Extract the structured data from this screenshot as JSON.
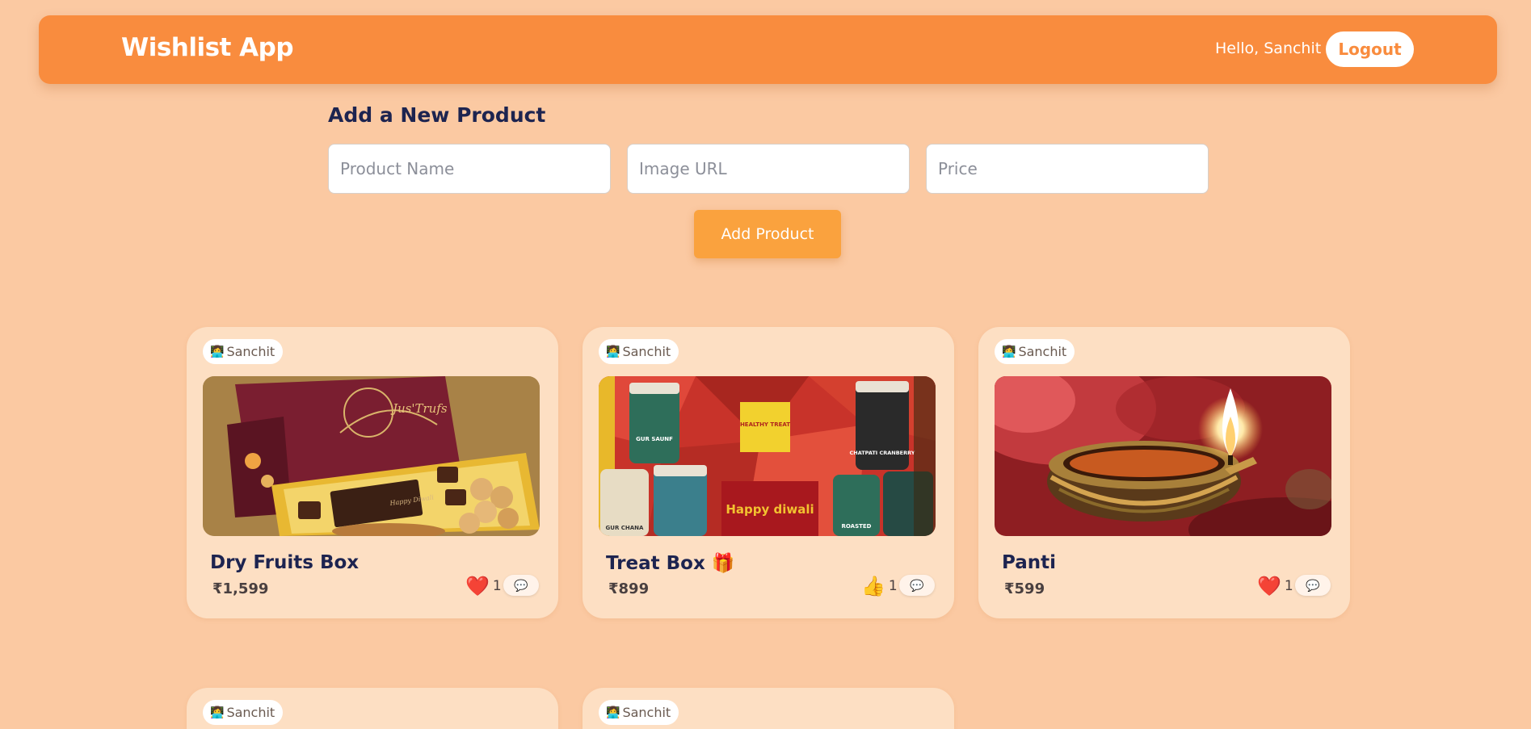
{
  "header": {
    "brand": "Wishlist App",
    "greeting": "Hello, Sanchit",
    "logout_label": "Logout"
  },
  "form": {
    "title": "Add a New Product",
    "name_placeholder": "Product Name",
    "image_placeholder": "Image URL",
    "price_placeholder": "Price",
    "submit_label": "Add Product"
  },
  "colors": {
    "page_bg": "#fbc9a2",
    "navbar": "#f98c3e",
    "card_bg": "#fddfc3",
    "button": "#faa23e",
    "title_text": "#1d2450"
  },
  "products": [
    {
      "owner": "Sanchit",
      "owner_icon": "👩‍💻",
      "name": "Dry Fruits Box",
      "price": "₹1,599",
      "reaction_icon": "❤️",
      "reaction_count": "1",
      "comment_icon": "💬",
      "image_subject": "chocolate-gift-box",
      "image_text": [
        "Jus'Trufs",
        "Happy Diwali"
      ]
    },
    {
      "owner": "Sanchit",
      "owner_icon": "👩‍💻",
      "name": "Treat Box 🎁",
      "price": "₹899",
      "reaction_icon": "👍",
      "reaction_count": "1",
      "comment_icon": "💬",
      "image_subject": "snack-jars-hamper",
      "image_text": [
        "HEALTHY TREAT",
        "GUR SAUNF",
        "CHATPATI CRANBERRY",
        "Happy diwali",
        "ROASTED",
        "GUR CHANA"
      ]
    },
    {
      "owner": "Sanchit",
      "owner_icon": "👩‍💻",
      "name": "Panti",
      "price": "₹599",
      "reaction_icon": "❤️",
      "reaction_count": "1",
      "comment_icon": "💬",
      "image_subject": "diya-oil-lamp"
    },
    {
      "owner": "Sanchit",
      "owner_icon": "👩‍💻"
    },
    {
      "owner": "Sanchit",
      "owner_icon": "👩‍💻"
    }
  ]
}
